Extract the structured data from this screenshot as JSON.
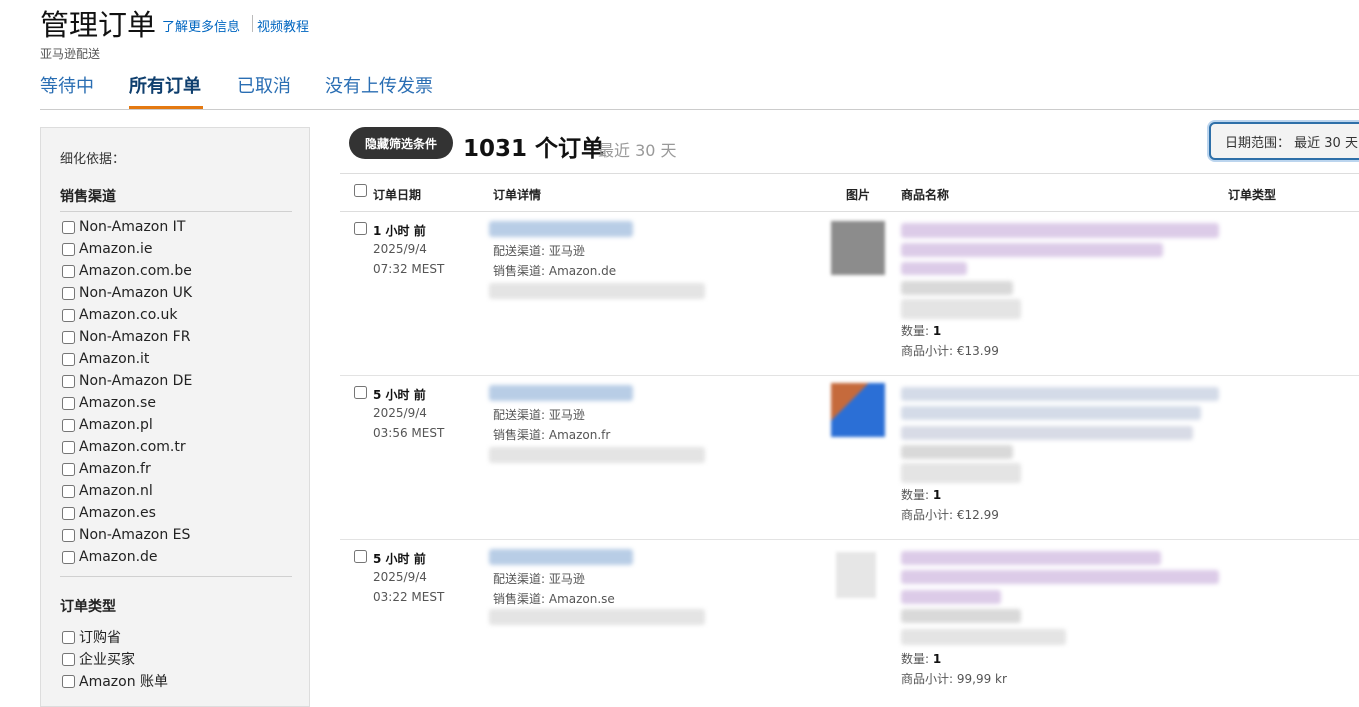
{
  "header": {
    "title": "管理订单",
    "learn_more": "了解更多信息",
    "video_tutorial": "视频教程",
    "subtitle": "亚马逊配送"
  },
  "tabs": [
    {
      "label": "等待中",
      "active": false
    },
    {
      "label": "所有订单",
      "active": true
    },
    {
      "label": "已取消",
      "active": false
    },
    {
      "label": "没有上传发票",
      "active": false
    }
  ],
  "sidebar": {
    "refine_label": "细化依据：",
    "sales_channel_heading": "销售渠道",
    "sales_channels": [
      "Non-Amazon IT",
      "Amazon.ie",
      "Amazon.com.be",
      "Non-Amazon UK",
      "Amazon.co.uk",
      "Non-Amazon FR",
      "Amazon.it",
      "Non-Amazon DE",
      "Amazon.se",
      "Amazon.pl",
      "Amazon.com.tr",
      "Amazon.fr",
      "Amazon.nl",
      "Amazon.es",
      "Non-Amazon ES",
      "Amazon.de"
    ],
    "order_type_heading": "订单类型",
    "order_types": [
      "订购省",
      "企业买家",
      "Amazon 账单"
    ]
  },
  "toolbar": {
    "hide_filters": "隐藏筛选条件",
    "order_count": "1031 个订单",
    "range_label": "最近 30 天",
    "date_range_button": "日期范围： 最近 30 天"
  },
  "table": {
    "columns": {
      "order_date": "订单日期",
      "order_details": "订单详情",
      "image": "图片",
      "product_name": "商品名称",
      "order_type": "订单类型"
    },
    "rows": [
      {
        "time_ago": "1 小时 前",
        "date": "2025/9/4",
        "time": "07:32 MEST",
        "fulfillment": "配送渠道: 亚马逊",
        "sales_channel": "销售渠道: Amazon.de",
        "quantity_label": "数量:",
        "quantity": "1",
        "subtotal": "商品小计: €13.99"
      },
      {
        "time_ago": "5 小时 前",
        "date": "2025/9/4",
        "time": "03:56 MEST",
        "fulfillment": "配送渠道: 亚马逊",
        "sales_channel": "销售渠道: Amazon.fr",
        "quantity_label": "数量:",
        "quantity": "1",
        "subtotal": "商品小计: €12.99"
      },
      {
        "time_ago": "5 小时 前",
        "date": "2025/9/4",
        "time": "03:22 MEST",
        "fulfillment": "配送渠道: 亚马逊",
        "sales_channel": "销售渠道: Amazon.se",
        "quantity_label": "数量:",
        "quantity": "1",
        "subtotal": "商品小计: 99,99 kr"
      }
    ]
  },
  "colors": {
    "link": "#0066c0",
    "tab_accent": "#e47911",
    "button_dark": "#333333"
  }
}
